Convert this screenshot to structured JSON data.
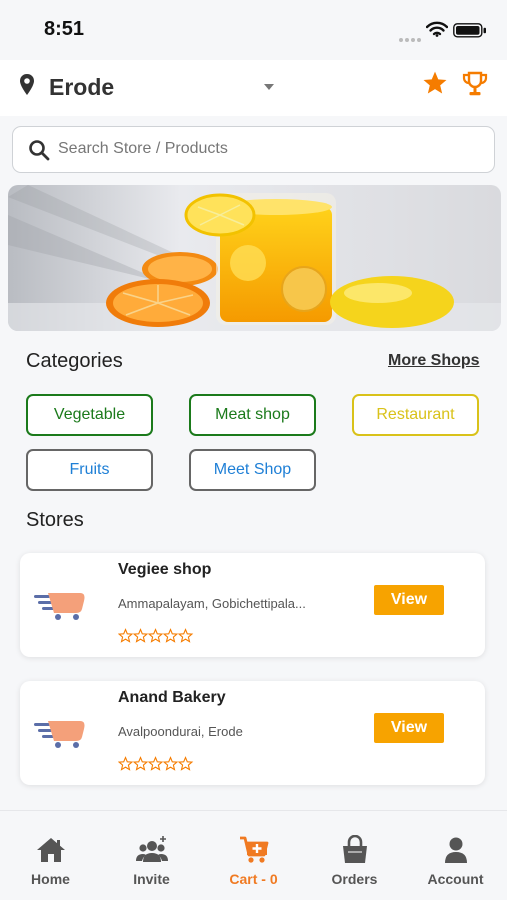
{
  "status_bar": {
    "time": "8:51"
  },
  "header": {
    "location": "Erode"
  },
  "search": {
    "placeholder": "Search Store / Products"
  },
  "categories": {
    "title": "Categories",
    "more_link": "More Shops",
    "items": [
      {
        "label": "Vegetable",
        "border": "#1b7a1b",
        "color": "#1b7a1b"
      },
      {
        "label": "Meat shop",
        "border": "#1b7a1b",
        "color": "#1b7a1b"
      },
      {
        "label": "Restaurant",
        "border": "#d9c21a",
        "color": "#d9c21a"
      },
      {
        "label": "Fruits",
        "border": "#666666",
        "color": "#1e7fd6"
      },
      {
        "label": "Meet Shop",
        "border": "#666666",
        "color": "#1e7fd6"
      }
    ]
  },
  "stores": {
    "title": "Stores",
    "items": [
      {
        "name": "Vegiee shop",
        "address": "Ammapalayam, Gobichettipala...",
        "rating": 0,
        "view_label": "View"
      },
      {
        "name": "Anand Bakery",
        "address": "Avalpoondurai, Erode",
        "rating": 0,
        "view_label": "View"
      }
    ]
  },
  "bottom_nav": {
    "items": [
      {
        "label": "Home",
        "icon": "home-icon"
      },
      {
        "label": "Invite",
        "icon": "invite-icon"
      },
      {
        "label": "Cart - 0",
        "icon": "cart-icon"
      },
      {
        "label": "Orders",
        "icon": "shopping-bag-icon"
      },
      {
        "label": "Account",
        "icon": "account-icon"
      }
    ],
    "active_index": 2
  },
  "colors": {
    "accent": "#f7a300",
    "active_nav": "#f07a22",
    "star": "#f57c00"
  }
}
